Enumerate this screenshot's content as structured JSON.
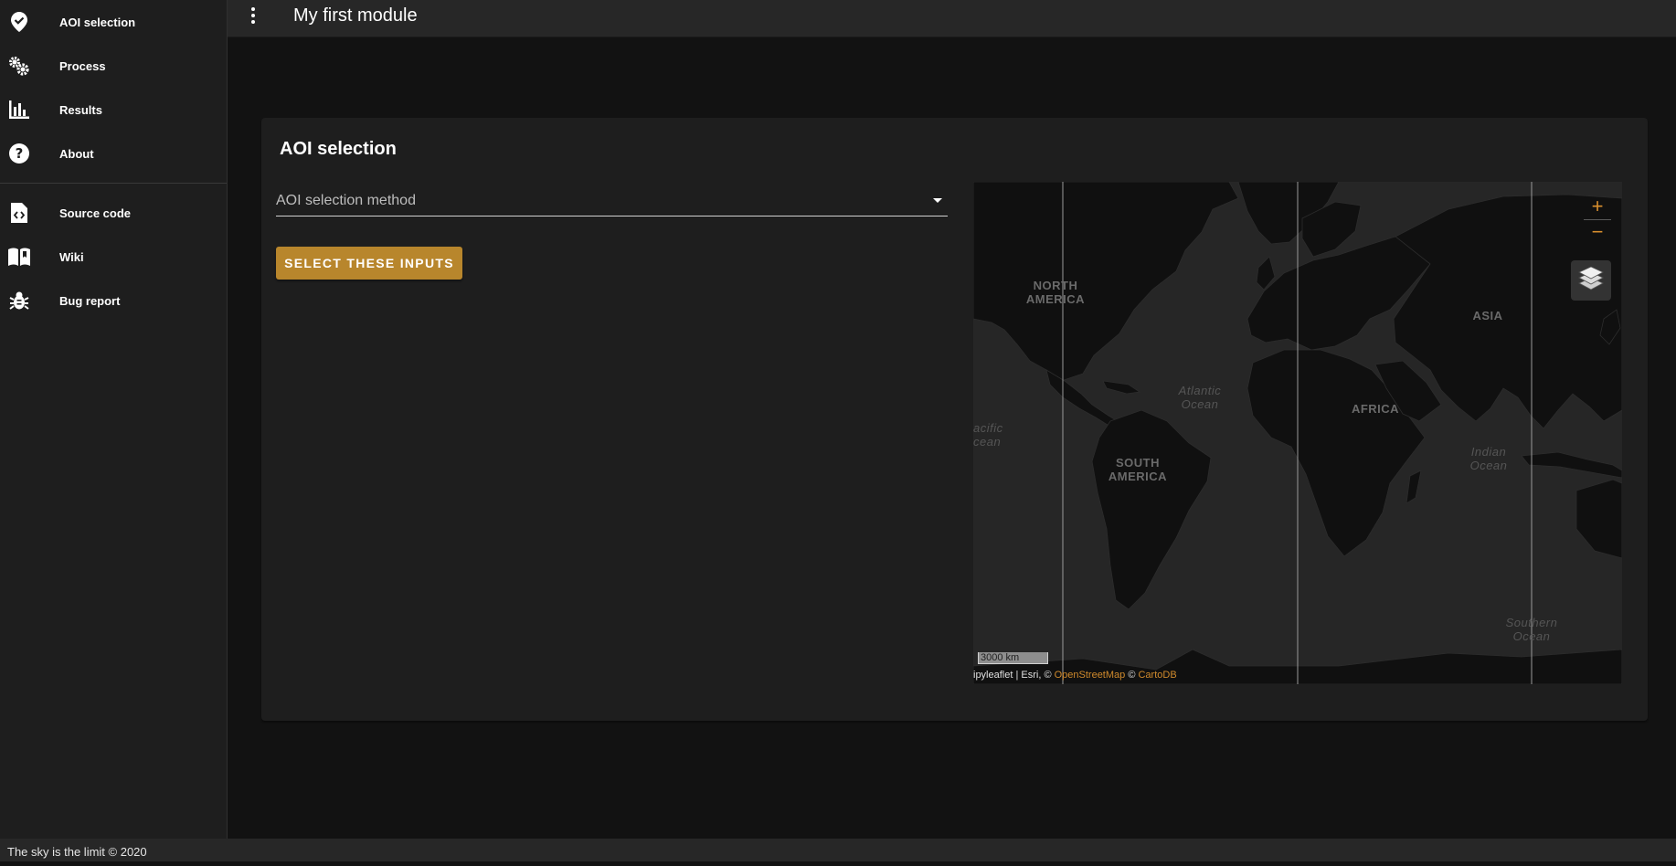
{
  "sidebar": {
    "items": [
      {
        "label": "AOI selection",
        "icon": "map-marker-check-icon"
      },
      {
        "label": "Process",
        "icon": "cogs-icon"
      },
      {
        "label": "Results",
        "icon": "bar-chart-icon"
      },
      {
        "label": "About",
        "icon": "help-circle-icon"
      },
      {
        "label": "Source code",
        "icon": "file-code-icon"
      },
      {
        "label": "Wiki",
        "icon": "book-open-icon"
      },
      {
        "label": "Bug report",
        "icon": "bug-icon"
      }
    ]
  },
  "appbar": {
    "title": "My first module"
  },
  "card": {
    "title": "AOI selection",
    "select_placeholder": "AOI selection method",
    "button_label": "SELECT THESE INPUTS"
  },
  "map": {
    "zoom_in": "+",
    "zoom_out": "−",
    "scale_label": "3000 km",
    "attribution_prefix": "ipyleaflet | Esri, © ",
    "attribution_osm": "OpenStreetMap",
    "attribution_sep": " © ",
    "attribution_carto": "CartoDB",
    "labels": {
      "north_america_1": "NORTH",
      "north_america_2": "AMERICA",
      "south_america_1": "SOUTH",
      "south_america_2": "AMERICA",
      "africa": "AFRICA",
      "asia": "ASIA",
      "atlantic_1": "Atlantic",
      "atlantic_2": "Ocean",
      "pacific_1": "acific",
      "pacific_2": "cean",
      "indian_1": "Indian",
      "indian_2": "Ocean",
      "southern_1": "Southern",
      "southern_2": "Ocean"
    }
  },
  "footer": {
    "text": "The sky is the limit © 2020"
  },
  "colors": {
    "accent": "#b8862c",
    "link": "#d08a2c",
    "background": "#121212",
    "surface": "#1e1e1e"
  }
}
